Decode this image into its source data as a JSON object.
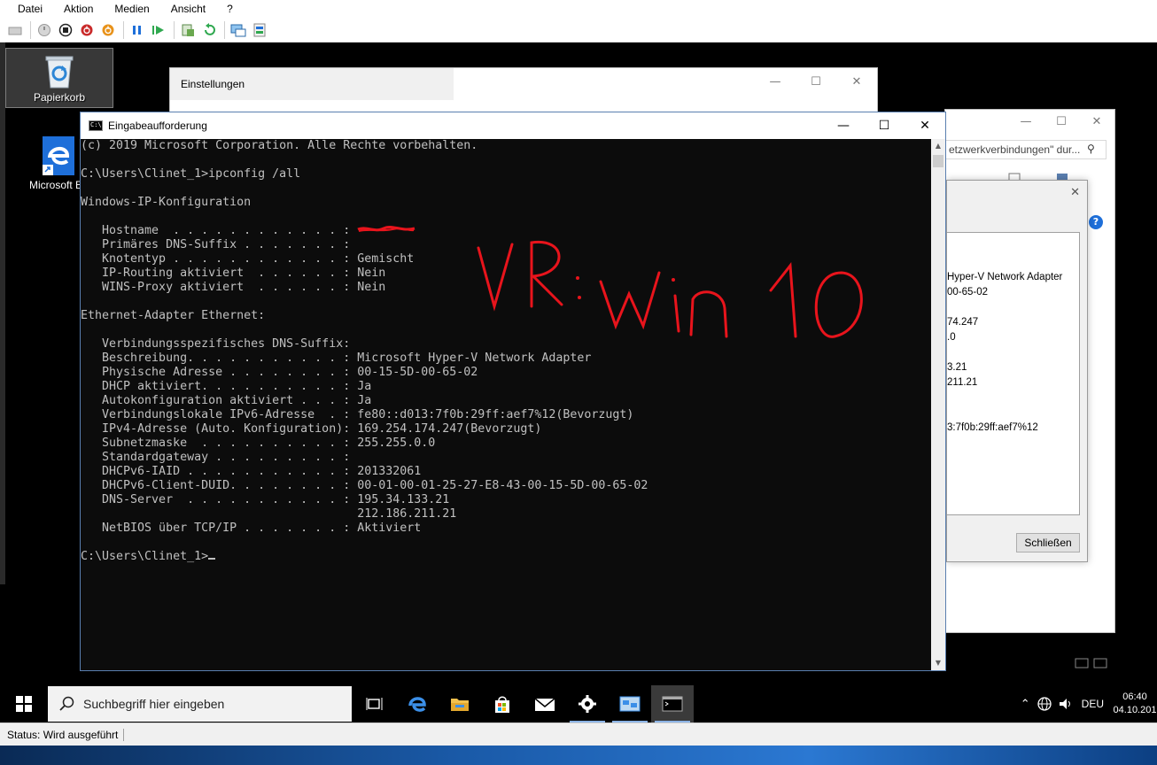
{
  "host": {
    "menu": [
      "Datei",
      "Aktion",
      "Medien",
      "Ansicht",
      "?"
    ],
    "status": "Status: Wird ausgeführt"
  },
  "desktop": {
    "recycle_bin": "Papierkorb",
    "edge": "Microsoft Ec"
  },
  "settings_window": {
    "title": "Einstellungen"
  },
  "network_window": {
    "search_text": "etzwerkverbindungen\" dur...",
    "help": "?"
  },
  "status_dialog": {
    "values": [
      "Hyper-V Network Adapter",
      "00-65-02",
      "74.247",
      ".0",
      "3.21",
      "211.21",
      "3:7f0b:29ff:aef7%12"
    ],
    "close_button": "Schließen"
  },
  "cmd": {
    "title": "Eingabeaufforderung",
    "lines": [
      "(c) 2019 Microsoft Corporation. Alle Rechte vorbehalten.",
      "",
      "C:\\Users\\Clinet_1>ipconfig /all",
      "",
      "Windows-IP-Konfiguration",
      "",
      "   Hostname  . . . . . . . . . . . . : ",
      "   Primäres DNS-Suffix . . . . . . . : ",
      "   Knotentyp . . . . . . . . . . . . : Gemischt",
      "   IP-Routing aktiviert  . . . . . . : Nein",
      "   WINS-Proxy aktiviert  . . . . . . : Nein",
      "",
      "Ethernet-Adapter Ethernet:",
      "",
      "   Verbindungsspezifisches DNS-Suffix: ",
      "   Beschreibung. . . . . . . . . . . : Microsoft Hyper-V Network Adapter",
      "   Physische Adresse . . . . . . . . : 00-15-5D-00-65-02",
      "   DHCP aktiviert. . . . . . . . . . : Ja",
      "   Autokonfiguration aktiviert . . . : Ja",
      "   Verbindungslokale IPv6-Adresse  . : fe80::d013:7f0b:29ff:aef7%12(Bevorzugt)",
      "   IPv4-Adresse (Auto. Konfiguration): 169.254.174.247(Bevorzugt)",
      "   Subnetzmaske  . . . . . . . . . . : 255.255.0.0",
      "   Standardgateway . . . . . . . . . : ",
      "   DHCPv6-IAID . . . . . . . . . . . : 201332061",
      "   DHCPv6-Client-DUID. . . . . . . . : 00-01-00-01-25-27-E8-43-00-15-5D-00-65-02",
      "   DNS-Server  . . . . . . . . . . . : 195.34.133.21",
      "                                       212.186.211.21",
      "   NetBIOS über TCP/IP . . . . . . . : Aktiviert",
      ""
    ],
    "prompt": "C:\\Users\\Clinet_1>"
  },
  "annotation": "VR: win 10",
  "taskbar": {
    "search_placeholder": "Suchbegriff hier eingeben",
    "language": "DEU",
    "time": "06:40",
    "date": "04.10.201"
  },
  "colors": {
    "console_bg": "#0c0c0c",
    "console_fg": "#c0c0c0",
    "annotation": "#e8141c",
    "accent": "#1e6fd9"
  }
}
